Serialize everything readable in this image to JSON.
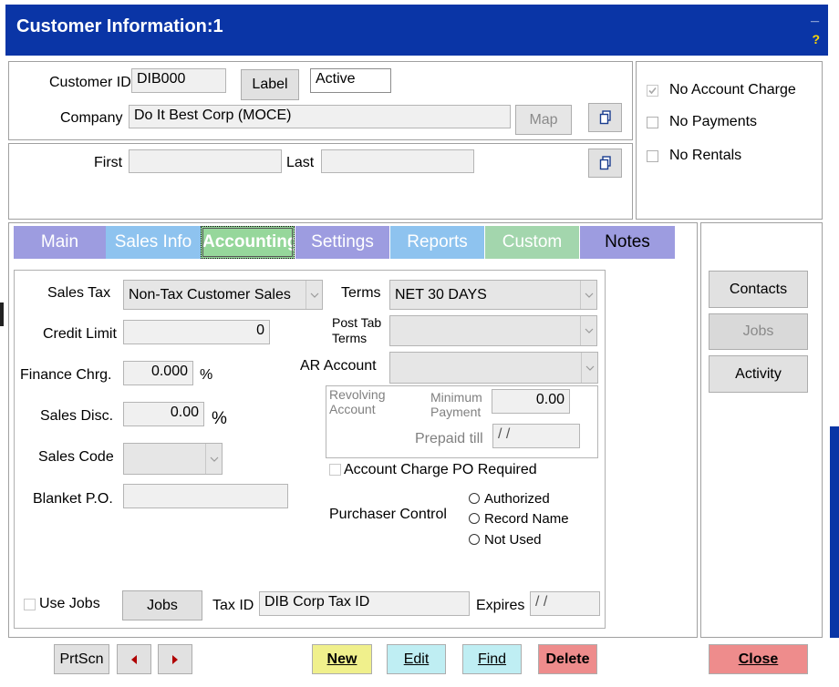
{
  "window": {
    "title": "Customer Information:1",
    "minimize_glyph": "_",
    "help_glyph": "?"
  },
  "customer": {
    "id_label": "Customer ID",
    "id_value": "DIB000",
    "label_button": "Label",
    "status": "Active",
    "company_label": "Company",
    "company_value": "Do It Best Corp (MOCE)",
    "map_button": "Map"
  },
  "name": {
    "first_label": "First",
    "last_label": "Last",
    "first_value": "",
    "last_value": ""
  },
  "flags": {
    "no_account_charge": "No Account Charge",
    "no_account_charge_checked": true,
    "no_payments": "No Payments",
    "no_rentals": "No Rentals"
  },
  "tabs": [
    {
      "label": "Main",
      "color": "#9d9ce0"
    },
    {
      "label": "Sales Info",
      "color": "#8ec3ef"
    },
    {
      "label": "Accounting",
      "color": "#96d79b",
      "active": true
    },
    {
      "label": "Settings",
      "color": "#9d9ce0"
    },
    {
      "label": "Reports",
      "color": "#8ec3ef"
    },
    {
      "label": "Custom",
      "color": "#a3d6ad"
    },
    {
      "label": "Notes",
      "color": "#9d9ce0"
    }
  ],
  "accounting": {
    "sales_tax_label": "Sales Tax",
    "sales_tax_value": "Non-Tax Customer Sales",
    "credit_limit_label": "Credit Limit",
    "credit_limit_value": "0",
    "finance_label": "Finance Chrg.",
    "finance_value": "0.000",
    "finance_unit": "%",
    "sales_disc_label": "Sales Disc.",
    "sales_disc_value": "0.00",
    "sales_disc_unit": "%",
    "sales_code_label": "Sales Code",
    "sales_code_value": "",
    "blanket_po_label": "Blanket P.O.",
    "blanket_po_value": "",
    "terms_label": "Terms",
    "terms_value": "NET 30 DAYS",
    "post_tab_terms_label_1": "Post Tab",
    "post_tab_terms_label_2": "Terms",
    "post_tab_terms_value": "",
    "ar_account_label": "AR Account",
    "ar_account_value": "",
    "revolving_label_1": "Revolving",
    "revolving_label_2": "Account",
    "min_payment_label_1": "Minimum",
    "min_payment_label_2": "Payment",
    "min_payment_value": "0.00",
    "prepaid_label": "Prepaid till",
    "prepaid_value": "/ /",
    "po_required_label": "Account Charge PO Required",
    "purchaser_label": "Purchaser Control",
    "purchaser_options": [
      "Authorized",
      "Record Name",
      "Not Used"
    ],
    "use_jobs_label": "Use Jobs",
    "jobs_button": "Jobs",
    "tax_id_label": "Tax ID",
    "tax_id_value": "DIB Corp Tax ID",
    "expires_label": "Expires",
    "expires_value": "/ /"
  },
  "side_buttons": {
    "contacts": "Contacts",
    "jobs": "Jobs",
    "activity": "Activity"
  },
  "bottom": {
    "prtscn": "PrtScn",
    "new": "New",
    "edit": "Edit",
    "find": "Find",
    "delete": "Delete",
    "close": "Close"
  },
  "colors": {
    "title_bar": "#0a35a6",
    "new": "#f0f08c",
    "edit": "#bfeef3",
    "find": "#bfeef3",
    "delete": "#ee8c8c",
    "close": "#ee8c8c"
  }
}
